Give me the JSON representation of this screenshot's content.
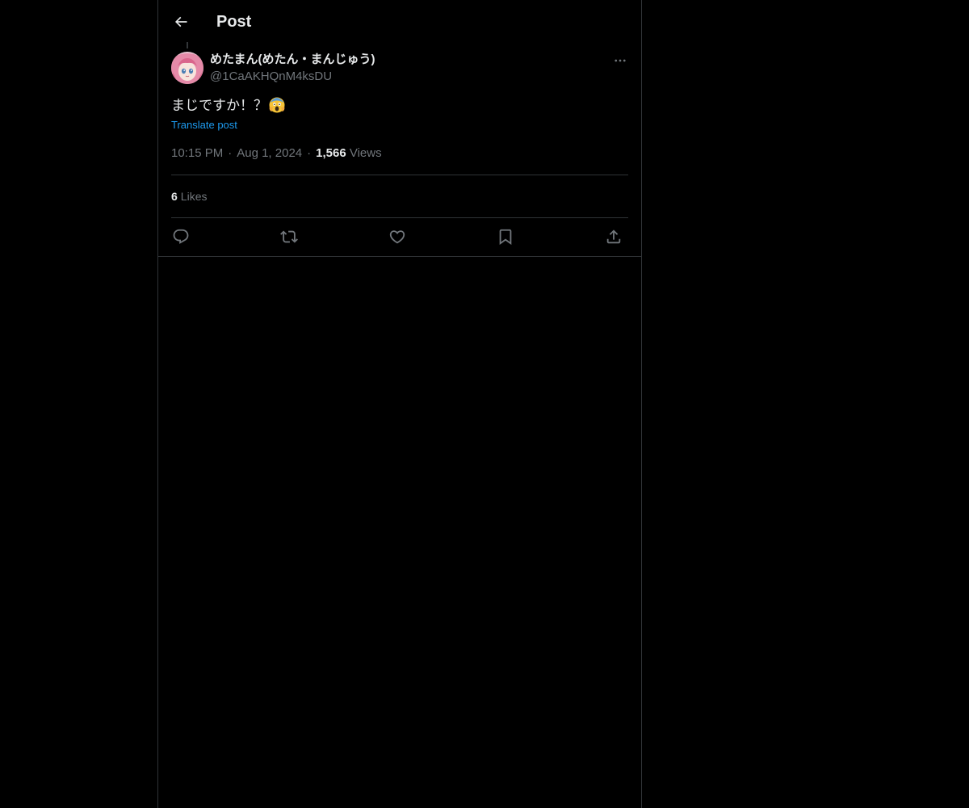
{
  "header": {
    "title": "Post",
    "back_icon": "arrow-left-icon"
  },
  "post": {
    "author": {
      "display_name": "めたまん(めたん・まんじゅう)",
      "handle": "@1CaAKHQnM4ksDU",
      "avatar_icon": "avatar"
    },
    "text": "まじですか！？",
    "emoji": "😱",
    "translate_label": "Translate post",
    "time": "10:15 PM",
    "date": "Aug 1, 2024",
    "separator": "·",
    "views_count": "1,566",
    "views_label": "Views",
    "likes_count": "6",
    "likes_label": "Likes"
  },
  "actions": [
    {
      "name": "reply",
      "icon": "reply-icon"
    },
    {
      "name": "repost",
      "icon": "repost-icon"
    },
    {
      "name": "like",
      "icon": "heart-icon"
    },
    {
      "name": "bookmark",
      "icon": "bookmark-icon"
    },
    {
      "name": "share",
      "icon": "share-icon"
    }
  ],
  "colors": {
    "background": "#000000",
    "text_primary": "#e7e9ea",
    "text_secondary": "#71767b",
    "link": "#1d9bf0",
    "border": "#2f3336"
  }
}
